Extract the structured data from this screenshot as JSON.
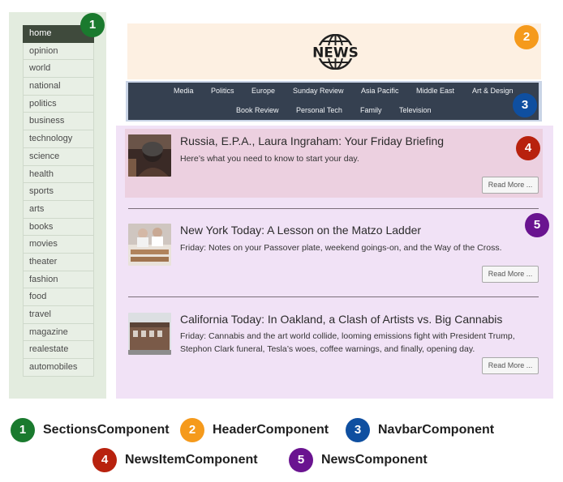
{
  "sections": {
    "items": [
      "home",
      "opinion",
      "world",
      "national",
      "politics",
      "business",
      "technology",
      "science",
      "health",
      "sports",
      "arts",
      "books",
      "movies",
      "theater",
      "fashion",
      "food",
      "travel",
      "magazine",
      "realestate",
      "automobiles"
    ],
    "active": "home"
  },
  "header": {
    "logo_text": "NEWS"
  },
  "navbar": {
    "row1": [
      "Media",
      "Politics",
      "Europe",
      "Sunday Review",
      "Asia Pacific",
      "Middle East",
      "Art & Design"
    ],
    "row2": [
      "Book Review",
      "Personal Tech",
      "Family",
      "Television"
    ]
  },
  "news": {
    "items": [
      {
        "title": "Russia, E.P.A., Laura Ingraham: Your Friday Briefing",
        "summary": "Here’s what you need to know to start your day.",
        "read_more": "Read More ..."
      },
      {
        "title": "New York Today: A Lesson on the Matzo Ladder",
        "summary": "Friday: Notes on your Passover plate, weekend goings-on, and the Way of the Cross.",
        "read_more": "Read More ..."
      },
      {
        "title": "California Today: In Oakland, a Clash of Artists vs. Big Cannabis",
        "summary": "Friday: Cannabis and the art world collide, looming emissions fight with President Trump, Stephon Clark funeral, Tesla’s woes, coffee warnings, and finally, opening day.",
        "read_more": "Read More ..."
      }
    ]
  },
  "badges": [
    "1",
    "2",
    "3",
    "4",
    "5"
  ],
  "legend": [
    {
      "number": "1",
      "label": "SectionsComponent"
    },
    {
      "number": "2",
      "label": "HeaderComponent"
    },
    {
      "number": "3",
      "label": "NavbarComponent"
    },
    {
      "number": "4",
      "label": "NewsItemComponent"
    },
    {
      "number": "5",
      "label": "NewsComponent"
    }
  ],
  "colors": {
    "sections": "#1a7a2e",
    "header": "#f59a1c",
    "navbar": "#0f4fa0",
    "news_item": "#b8220e",
    "news": "#6a1490"
  }
}
